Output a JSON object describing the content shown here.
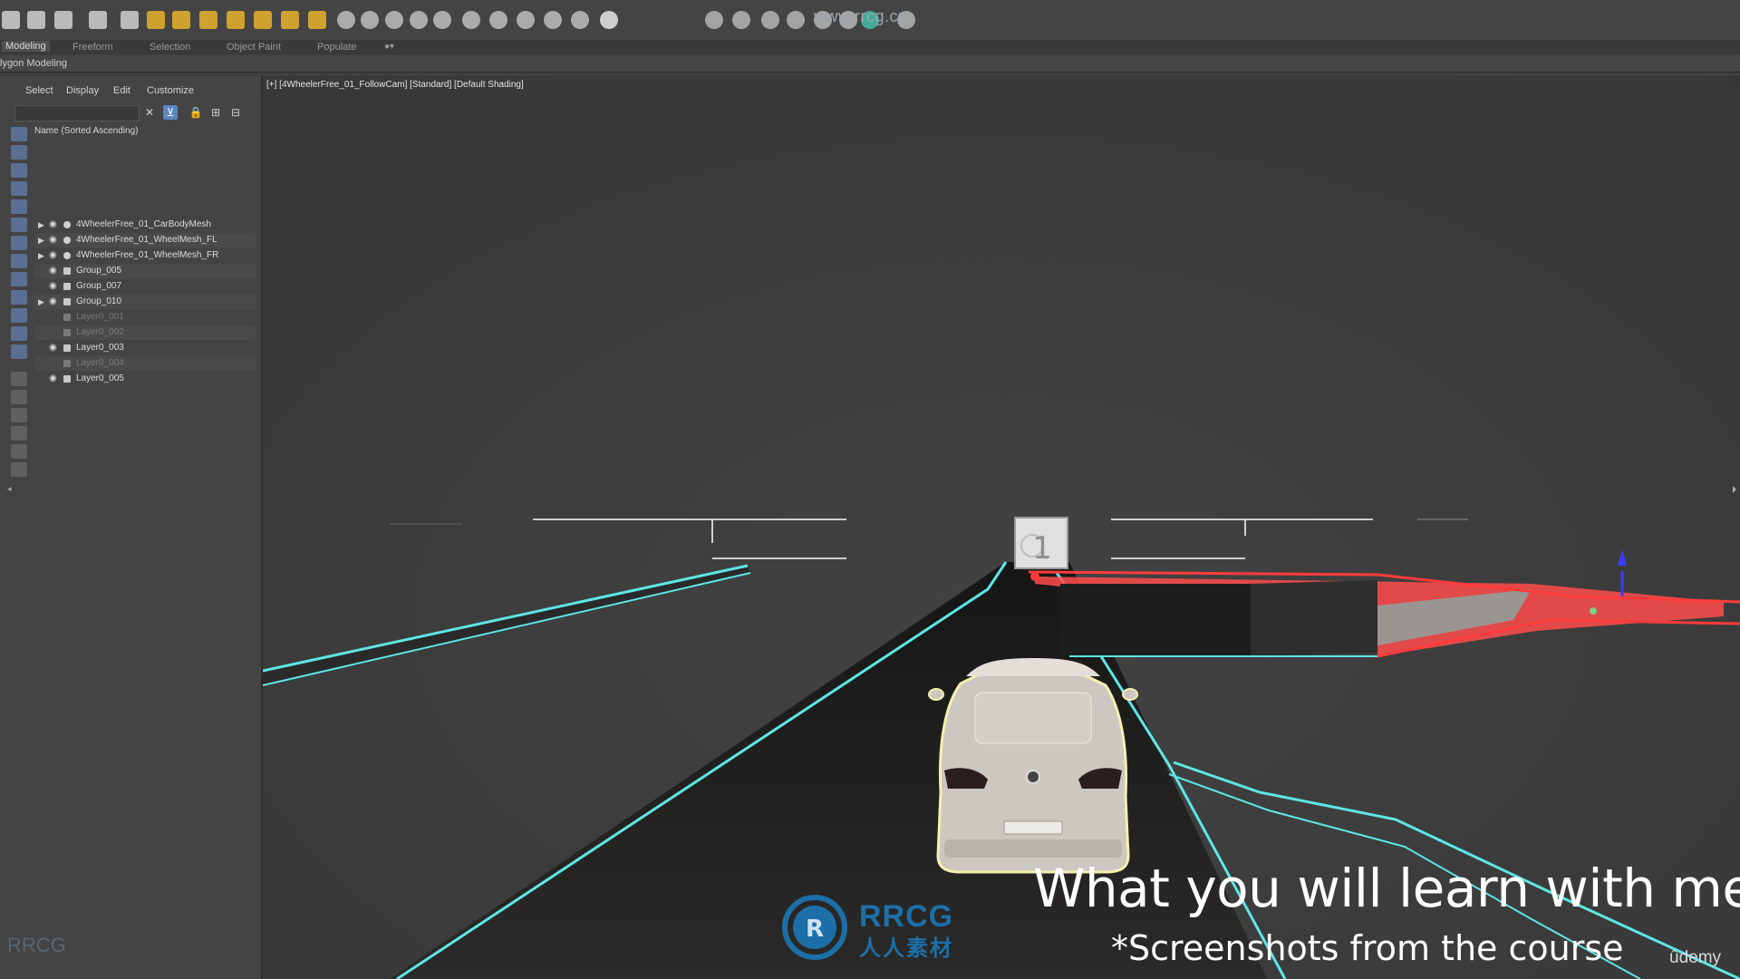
{
  "watermark_url": "www.rrcg.cn",
  "ribbon": {
    "tabs": [
      {
        "label": "Modeling",
        "active": true
      },
      {
        "label": "Freeform"
      },
      {
        "label": "Selection"
      },
      {
        "label": "Object Paint"
      },
      {
        "label": "Populate"
      }
    ],
    "subtitle": "lygon Modeling"
  },
  "toolbar_icons": [
    "select-object-icon",
    "select-by-name-icon",
    "layer-explorer-icon",
    "scene-explorer-icon",
    "render-setup-icon",
    "light-icon",
    "shape-icon",
    "sphere-icon",
    "helper-icon",
    "spacewarp-icon",
    "systems-icon",
    "sun-icon",
    "material-editor-icon",
    "render-frame-icon",
    "quick-render-icon",
    "environment-icon",
    "effects-icon",
    "curve-editor-icon",
    "schematic-icon",
    "material-icon",
    "teapot-icon",
    "settings-icon",
    "check-icon"
  ],
  "explorer": {
    "menu": [
      "Select",
      "Display",
      "Edit",
      "Customize"
    ],
    "column_header": "Name (Sorted Ascending)",
    "items": [
      {
        "label": "4WheelerFree_01_CarBodyMesh",
        "expandable": true,
        "dim": false
      },
      {
        "label": "4WheelerFree_01_WheelMesh_FL",
        "expandable": true,
        "dim": false
      },
      {
        "label": "4WheelerFree_01_WheelMesh_FR",
        "expandable": true,
        "dim": false
      },
      {
        "label": "Group_005",
        "expandable": false,
        "dim": false
      },
      {
        "label": "Group_007",
        "expandable": false,
        "dim": false
      },
      {
        "label": "Group_010",
        "expandable": true,
        "dim": false
      },
      {
        "label": "Layer0_001",
        "expandable": false,
        "dim": true
      },
      {
        "label": "Layer0_002",
        "expandable": false,
        "dim": true
      },
      {
        "label": "Layer0_003",
        "expandable": false,
        "dim": false
      },
      {
        "label": "Layer0_004",
        "expandable": false,
        "dim": true
      },
      {
        "label": "Layer0_005",
        "expandable": false,
        "dim": false
      }
    ]
  },
  "viewport": {
    "label": "[+] [4WheelerFree_01_FollowCam] [Standard] [Default Shading]",
    "checkpoint_number": "1"
  },
  "captions": {
    "main": "What you will learn with me",
    "sub": "*Screenshots from the course"
  },
  "brand": {
    "name": "RRCG",
    "chinese": "人人素材",
    "corner": "RRCG"
  },
  "udemy": "ûdemy",
  "colors": {
    "road_edge": "#5fe6e6",
    "selection_red": "#ff3b3b",
    "car_highlight": "#f4f0b0",
    "brand_blue": "#1d6fa8"
  }
}
